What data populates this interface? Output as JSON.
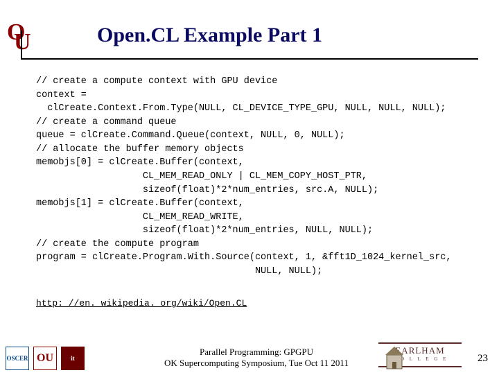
{
  "title": "Open.CL Example Part 1",
  "code_lines": [
    "// create a compute context with GPU device",
    "context =",
    "  clCreate.Context.From.Type(NULL, CL_DEVICE_TYPE_GPU, NULL, NULL, NULL);",
    "// create a command queue",
    "queue = clCreate.Command.Queue(context, NULL, 0, NULL);",
    "// allocate the buffer memory objects",
    "memobjs[0] = clCreate.Buffer(context,",
    "                   CL_MEM_READ_ONLY | CL_MEM_COPY_HOST_PTR,",
    "                   sizeof(float)*2*num_entries, src.A, NULL);",
    "memobjs[1] = clCreate.Buffer(context,",
    "                   CL_MEM_READ_WRITE,",
    "                   sizeof(float)*2*num_entries, NULL, NULL);",
    "// create the compute program",
    "program = clCreate.Program.With.Source(context, 1, &fft1D_1024_kernel_src,",
    "                                       NULL, NULL);"
  ],
  "link": "http: //en. wikipedia. org/wiki/Open.CL",
  "footer": {
    "line1": "Parallel Programming: GPGPU",
    "line2": "OK Supercomputing Symposium, Tue Oct 11 2011"
  },
  "logos": {
    "oscer": "OSCER",
    "ou": "OU",
    "it": "it",
    "earlham_top": "EARLHAM",
    "earlham_bottom": "C O L L E G E"
  },
  "page_number": "23"
}
